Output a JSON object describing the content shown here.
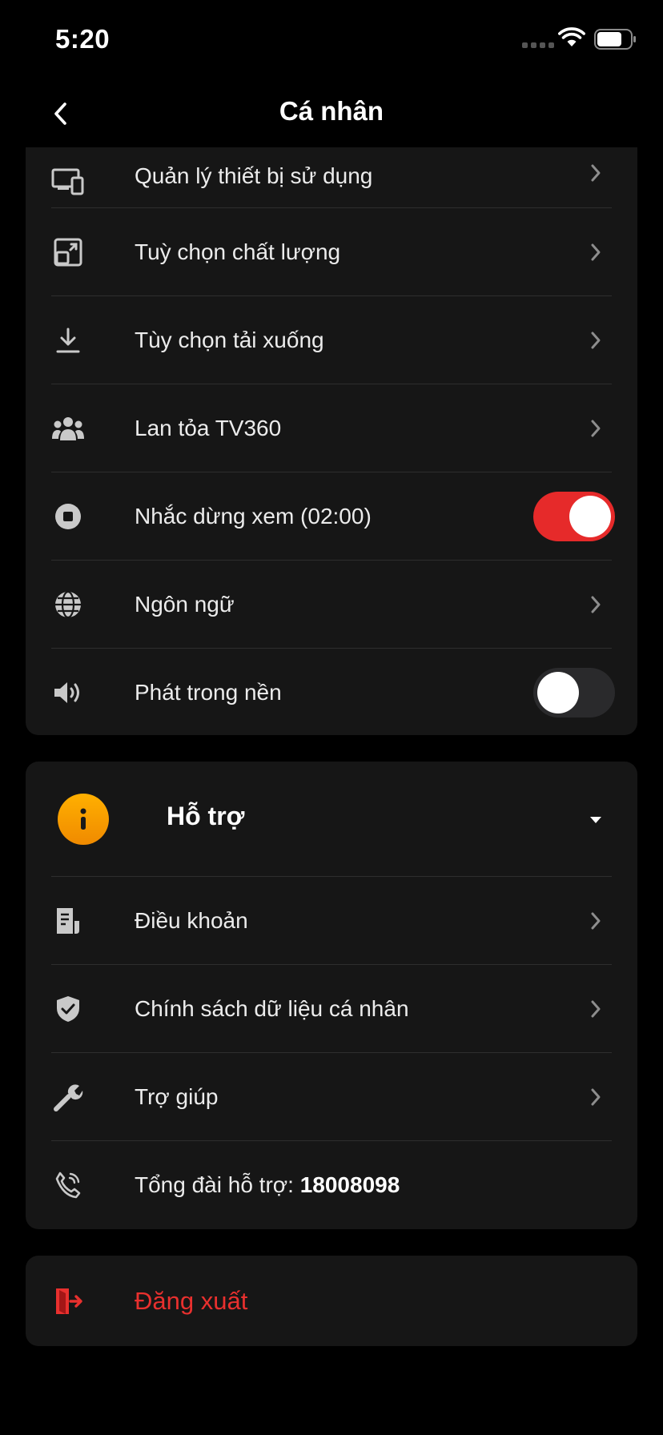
{
  "status_bar": {
    "time": "5:20"
  },
  "header": {
    "title": "Cá nhân"
  },
  "settings": {
    "items": [
      {
        "label": "Quản lý thiết bị sử dụng",
        "icon": "devices-icon"
      },
      {
        "label": "Tuỳ chọn chất lượng",
        "icon": "quality-icon"
      },
      {
        "label": "Tùy chọn tải xuống",
        "icon": "download-icon"
      },
      {
        "label": "Lan tỏa TV360",
        "icon": "people-icon"
      },
      {
        "label": "Nhắc dừng xem (02:00)",
        "icon": "stop-icon",
        "toggle": true
      },
      {
        "label": "Ngôn ngữ",
        "icon": "globe-icon"
      },
      {
        "label": "Phát trong nền",
        "icon": "speaker-icon",
        "toggle": false
      }
    ]
  },
  "support": {
    "title": "Hỗ trợ",
    "items": [
      {
        "label": "Điều khoản",
        "icon": "document-icon"
      },
      {
        "label": "Chính sách dữ liệu cá nhân",
        "icon": "shield-icon"
      },
      {
        "label": "Trợ giúp",
        "icon": "wrench-icon"
      }
    ],
    "hotline_label": "Tổng đài hỗ trợ: ",
    "hotline_number": "18008098"
  },
  "logout": {
    "label": "Đăng xuất"
  },
  "colors": {
    "accent": "#e62a2a",
    "support_badge": "#ffa500",
    "card_bg": "#161616",
    "background": "#000000"
  }
}
